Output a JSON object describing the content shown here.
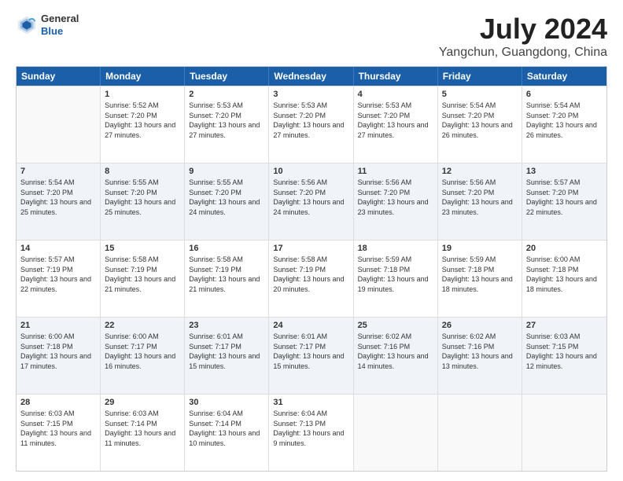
{
  "header": {
    "logo_general": "General",
    "logo_blue": "Blue",
    "title": "July 2024",
    "subtitle": "Yangchun, Guangdong, China"
  },
  "weekdays": [
    "Sunday",
    "Monday",
    "Tuesday",
    "Wednesday",
    "Thursday",
    "Friday",
    "Saturday"
  ],
  "rows": [
    [
      {
        "day": "",
        "sunrise": "",
        "sunset": "",
        "daylight": ""
      },
      {
        "day": "1",
        "sunrise": "Sunrise: 5:52 AM",
        "sunset": "Sunset: 7:20 PM",
        "daylight": "Daylight: 13 hours and 27 minutes."
      },
      {
        "day": "2",
        "sunrise": "Sunrise: 5:53 AM",
        "sunset": "Sunset: 7:20 PM",
        "daylight": "Daylight: 13 hours and 27 minutes."
      },
      {
        "day": "3",
        "sunrise": "Sunrise: 5:53 AM",
        "sunset": "Sunset: 7:20 PM",
        "daylight": "Daylight: 13 hours and 27 minutes."
      },
      {
        "day": "4",
        "sunrise": "Sunrise: 5:53 AM",
        "sunset": "Sunset: 7:20 PM",
        "daylight": "Daylight: 13 hours and 27 minutes."
      },
      {
        "day": "5",
        "sunrise": "Sunrise: 5:54 AM",
        "sunset": "Sunset: 7:20 PM",
        "daylight": "Daylight: 13 hours and 26 minutes."
      },
      {
        "day": "6",
        "sunrise": "Sunrise: 5:54 AM",
        "sunset": "Sunset: 7:20 PM",
        "daylight": "Daylight: 13 hours and 26 minutes."
      }
    ],
    [
      {
        "day": "7",
        "sunrise": "Sunrise: 5:54 AM",
        "sunset": "Sunset: 7:20 PM",
        "daylight": "Daylight: 13 hours and 25 minutes."
      },
      {
        "day": "8",
        "sunrise": "Sunrise: 5:55 AM",
        "sunset": "Sunset: 7:20 PM",
        "daylight": "Daylight: 13 hours and 25 minutes."
      },
      {
        "day": "9",
        "sunrise": "Sunrise: 5:55 AM",
        "sunset": "Sunset: 7:20 PM",
        "daylight": "Daylight: 13 hours and 24 minutes."
      },
      {
        "day": "10",
        "sunrise": "Sunrise: 5:56 AM",
        "sunset": "Sunset: 7:20 PM",
        "daylight": "Daylight: 13 hours and 24 minutes."
      },
      {
        "day": "11",
        "sunrise": "Sunrise: 5:56 AM",
        "sunset": "Sunset: 7:20 PM",
        "daylight": "Daylight: 13 hours and 23 minutes."
      },
      {
        "day": "12",
        "sunrise": "Sunrise: 5:56 AM",
        "sunset": "Sunset: 7:20 PM",
        "daylight": "Daylight: 13 hours and 23 minutes."
      },
      {
        "day": "13",
        "sunrise": "Sunrise: 5:57 AM",
        "sunset": "Sunset: 7:20 PM",
        "daylight": "Daylight: 13 hours and 22 minutes."
      }
    ],
    [
      {
        "day": "14",
        "sunrise": "Sunrise: 5:57 AM",
        "sunset": "Sunset: 7:19 PM",
        "daylight": "Daylight: 13 hours and 22 minutes."
      },
      {
        "day": "15",
        "sunrise": "Sunrise: 5:58 AM",
        "sunset": "Sunset: 7:19 PM",
        "daylight": "Daylight: 13 hours and 21 minutes."
      },
      {
        "day": "16",
        "sunrise": "Sunrise: 5:58 AM",
        "sunset": "Sunset: 7:19 PM",
        "daylight": "Daylight: 13 hours and 21 minutes."
      },
      {
        "day": "17",
        "sunrise": "Sunrise: 5:58 AM",
        "sunset": "Sunset: 7:19 PM",
        "daylight": "Daylight: 13 hours and 20 minutes."
      },
      {
        "day": "18",
        "sunrise": "Sunrise: 5:59 AM",
        "sunset": "Sunset: 7:18 PM",
        "daylight": "Daylight: 13 hours and 19 minutes."
      },
      {
        "day": "19",
        "sunrise": "Sunrise: 5:59 AM",
        "sunset": "Sunset: 7:18 PM",
        "daylight": "Daylight: 13 hours and 18 minutes."
      },
      {
        "day": "20",
        "sunrise": "Sunrise: 6:00 AM",
        "sunset": "Sunset: 7:18 PM",
        "daylight": "Daylight: 13 hours and 18 minutes."
      }
    ],
    [
      {
        "day": "21",
        "sunrise": "Sunrise: 6:00 AM",
        "sunset": "Sunset: 7:18 PM",
        "daylight": "Daylight: 13 hours and 17 minutes."
      },
      {
        "day": "22",
        "sunrise": "Sunrise: 6:00 AM",
        "sunset": "Sunset: 7:17 PM",
        "daylight": "Daylight: 13 hours and 16 minutes."
      },
      {
        "day": "23",
        "sunrise": "Sunrise: 6:01 AM",
        "sunset": "Sunset: 7:17 PM",
        "daylight": "Daylight: 13 hours and 15 minutes."
      },
      {
        "day": "24",
        "sunrise": "Sunrise: 6:01 AM",
        "sunset": "Sunset: 7:17 PM",
        "daylight": "Daylight: 13 hours and 15 minutes."
      },
      {
        "day": "25",
        "sunrise": "Sunrise: 6:02 AM",
        "sunset": "Sunset: 7:16 PM",
        "daylight": "Daylight: 13 hours and 14 minutes."
      },
      {
        "day": "26",
        "sunrise": "Sunrise: 6:02 AM",
        "sunset": "Sunset: 7:16 PM",
        "daylight": "Daylight: 13 hours and 13 minutes."
      },
      {
        "day": "27",
        "sunrise": "Sunrise: 6:03 AM",
        "sunset": "Sunset: 7:15 PM",
        "daylight": "Daylight: 13 hours and 12 minutes."
      }
    ],
    [
      {
        "day": "28",
        "sunrise": "Sunrise: 6:03 AM",
        "sunset": "Sunset: 7:15 PM",
        "daylight": "Daylight: 13 hours and 11 minutes."
      },
      {
        "day": "29",
        "sunrise": "Sunrise: 6:03 AM",
        "sunset": "Sunset: 7:14 PM",
        "daylight": "Daylight: 13 hours and 11 minutes."
      },
      {
        "day": "30",
        "sunrise": "Sunrise: 6:04 AM",
        "sunset": "Sunset: 7:14 PM",
        "daylight": "Daylight: 13 hours and 10 minutes."
      },
      {
        "day": "31",
        "sunrise": "Sunrise: 6:04 AM",
        "sunset": "Sunset: 7:13 PM",
        "daylight": "Daylight: 13 hours and 9 minutes."
      },
      {
        "day": "",
        "sunrise": "",
        "sunset": "",
        "daylight": ""
      },
      {
        "day": "",
        "sunrise": "",
        "sunset": "",
        "daylight": ""
      },
      {
        "day": "",
        "sunrise": "",
        "sunset": "",
        "daylight": ""
      }
    ]
  ]
}
